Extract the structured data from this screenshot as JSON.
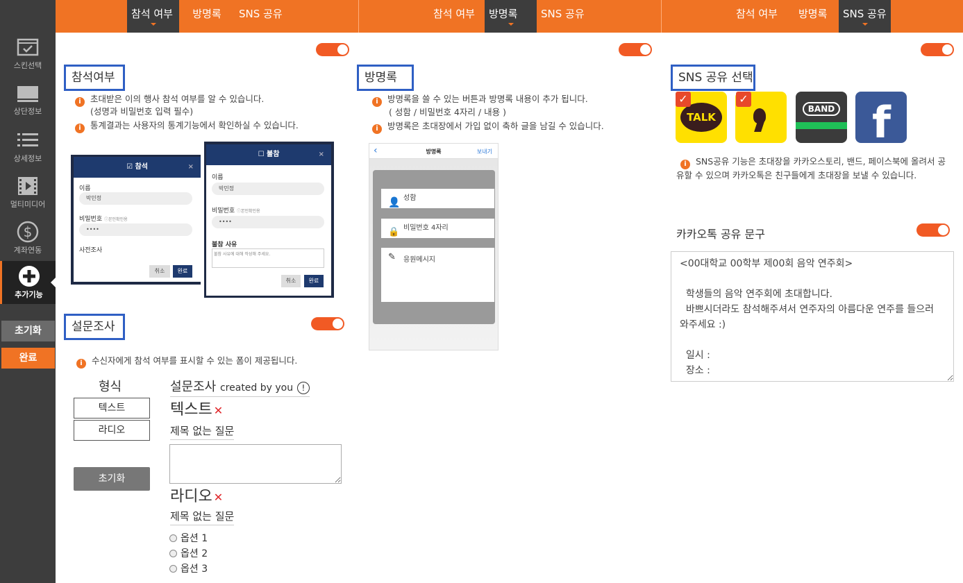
{
  "sidebar": {
    "items": [
      {
        "label": "스킨선택",
        "icon": "skin-select-icon"
      },
      {
        "label": "상단정보",
        "icon": "top-info-icon"
      },
      {
        "label": "상세정보",
        "icon": "detail-info-icon"
      },
      {
        "label": "멀티미디어",
        "icon": "multimedia-icon"
      },
      {
        "label": "계좌연동",
        "icon": "dollar-icon"
      },
      {
        "label": "추가기능",
        "icon": "plus-icon"
      }
    ],
    "reset_label": "초기화",
    "done_label": "완료"
  },
  "topbar": {
    "group1": [
      "참석 여부",
      "방명록",
      "SNS 공유"
    ],
    "group2": [
      "참석 여부",
      "방명록",
      "SNS 공유"
    ],
    "group3": [
      "참석 여부",
      "방명록",
      "SNS 공유"
    ]
  },
  "attendance": {
    "title": "참석여부",
    "info1": "초대받은 이의 행사 참석 여부를 알 수 있습니다.",
    "info1b": "(성명과 비밀번호 입력 필수)",
    "info2": "통계결과는 사용자의 통계기능에서 확인하실 수 있습니다.",
    "mock1": {
      "head": "참석",
      "name_label": "이름",
      "name_val": "박민정",
      "pw_label": "비밀번호",
      "pw_hint": "본인확인용",
      "pw_val": "••••",
      "survey": "사전조사",
      "cancel": "취소",
      "ok": "완료"
    },
    "mock2": {
      "head": "불참",
      "name_label": "이름",
      "name_val": "박민정",
      "pw_label": "비밀번호",
      "pw_hint": "본인확인용",
      "pw_val": "••••",
      "reason_label": "불참 사유",
      "reason_ph": "불참 사유에 대해 작성해 주세요.",
      "cancel": "취소",
      "ok": "완료"
    }
  },
  "survey": {
    "title": "설문조사",
    "info": "수신자에게 참석 여부를 표시할 수 있는 폼이 제공됩니다.",
    "format_label": "형식",
    "btn_text": "텍스트",
    "btn_radio": "라디오",
    "btn_reset": "초기화",
    "form_title": "설문조사",
    "form_by": "created by you",
    "text_heading": "텍스트",
    "text_q": "제목 없는 질문",
    "radio_heading": "라디오",
    "radio_q": "제목 없는 질문",
    "options": [
      "옵션 1",
      "옵션 2",
      "옵션 3"
    ]
  },
  "guestbook": {
    "title": "방명록",
    "info1": "방명록을 쓸 수 있는 버튼과 방명록 내용이 추가 됩니다.",
    "info1b": "( 성함 / 비밀번호 4자리 / 내용 )",
    "info2": "방명록은 초대장에서 가입 없이 축하 글을 남길 수 있습니다.",
    "mock": {
      "back": "‹",
      "head": "방명록",
      "send": "보내기",
      "name": "성함",
      "pw": "비밀번호 4자리",
      "msg": "응원메시지"
    }
  },
  "sns": {
    "title": "SNS 공유 선택",
    "icons": [
      "kakaotalk-icon",
      "kakaostory-icon",
      "band-icon",
      "facebook-icon"
    ],
    "talk_text": "TALK",
    "band_text": "BAND",
    "fb_text": "f",
    "info": "SNS공유 기능은 초대장을 카카오스토리, 밴드, 페이스북에 올려서 공유할 수 있으며 카카오톡은 친구들에게 초대장을 보낼 수 있습니다.",
    "kakao_title": "카카오톡 공유 문구",
    "kakao_text": "<00대학교 00학부 제00회 음악 연주회>\n\n  학생들의 음악 연주회에 초대합니다.\n  바쁘시더라도 참석해주셔서 연주자의 아름다운 연주를 들으러 와주세요 :)\n\n  일시 :\n  장소 :"
  },
  "colors": {
    "accent": "#f07324",
    "sidebar": "#3d3d3d",
    "toggle": "#f15a24",
    "title_border": "#2f5fc4"
  }
}
